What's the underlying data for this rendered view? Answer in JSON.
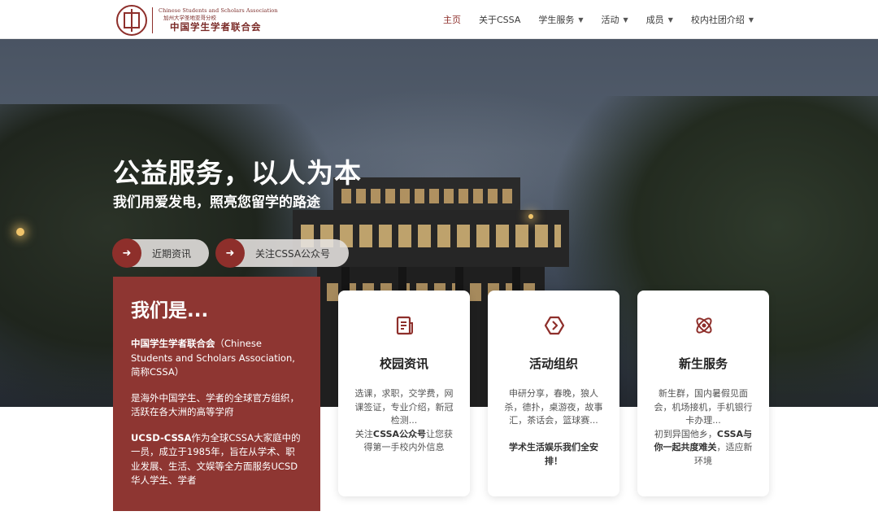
{
  "header": {
    "logo": {
      "en": "Chinese Students and Scholars Association",
      "cn_small": "加州大学圣地亚哥分校",
      "cn": "中国学生学者联合会"
    },
    "nav": [
      {
        "label": "主页",
        "dropdown": false,
        "active": true
      },
      {
        "label": "关于CSSA",
        "dropdown": false,
        "active": false
      },
      {
        "label": "学生服务",
        "dropdown": true,
        "active": false
      },
      {
        "label": "活动",
        "dropdown": true,
        "active": false
      },
      {
        "label": "成员",
        "dropdown": true,
        "active": false
      },
      {
        "label": "校内社团介绍",
        "dropdown": true,
        "active": false
      }
    ]
  },
  "hero": {
    "title": "公益服务，以人为本",
    "subtitle": "我们用爱发电，照亮您留学的路途",
    "buttons": [
      {
        "label": "近期资讯",
        "icon": "arrow-right-icon"
      },
      {
        "label": "关注CSSA公众号",
        "icon": "arrow-right-icon"
      }
    ]
  },
  "who": {
    "title": "我们是...",
    "p1_bold": "中国学生学者联合会",
    "p1_rest": "（Chinese Students and Scholars Association, 简称CSSA）",
    "p2": "是海外中国学生、学者的全球官方组织，活跃在各大洲的高等学府",
    "p3_bold": "UCSD-CSSA",
    "p3_rest": "作为全球CSSA大家庭中的一员，成立于1985年，旨在从学术、职业发展、生活、文娱等全方面服务UCSD华人学生、学者"
  },
  "cards": [
    {
      "icon": "news-icon",
      "title": "校园资讯",
      "line1": "选课，求职，交学费，网课签证，专业介绍，新冠检测...",
      "line2_pre": "关注",
      "line2_bold": "CSSA公众号",
      "line2_post": "让您获得第一手校内外信息"
    },
    {
      "icon": "hexagon-arrow-icon",
      "title": "活动组织",
      "line1": "申研分享，春晚，狼人杀，德扑，桌游夜，故事汇，茶话会，篮球赛...",
      "line2_bold": "学术生活娱乐我们全安排！"
    },
    {
      "icon": "atom-icon",
      "title": "新生服务",
      "line1": "新生群，国内暑假见面会，机场接机，手机银行卡办理...",
      "line2_pre": "初到异国他乡，",
      "line2_bold": "CSSA与你一起共度难关",
      "line2_post": "，适应新环境"
    }
  ],
  "colors": {
    "brand": "#8e2f2b",
    "who_bg": "#8e3632"
  }
}
